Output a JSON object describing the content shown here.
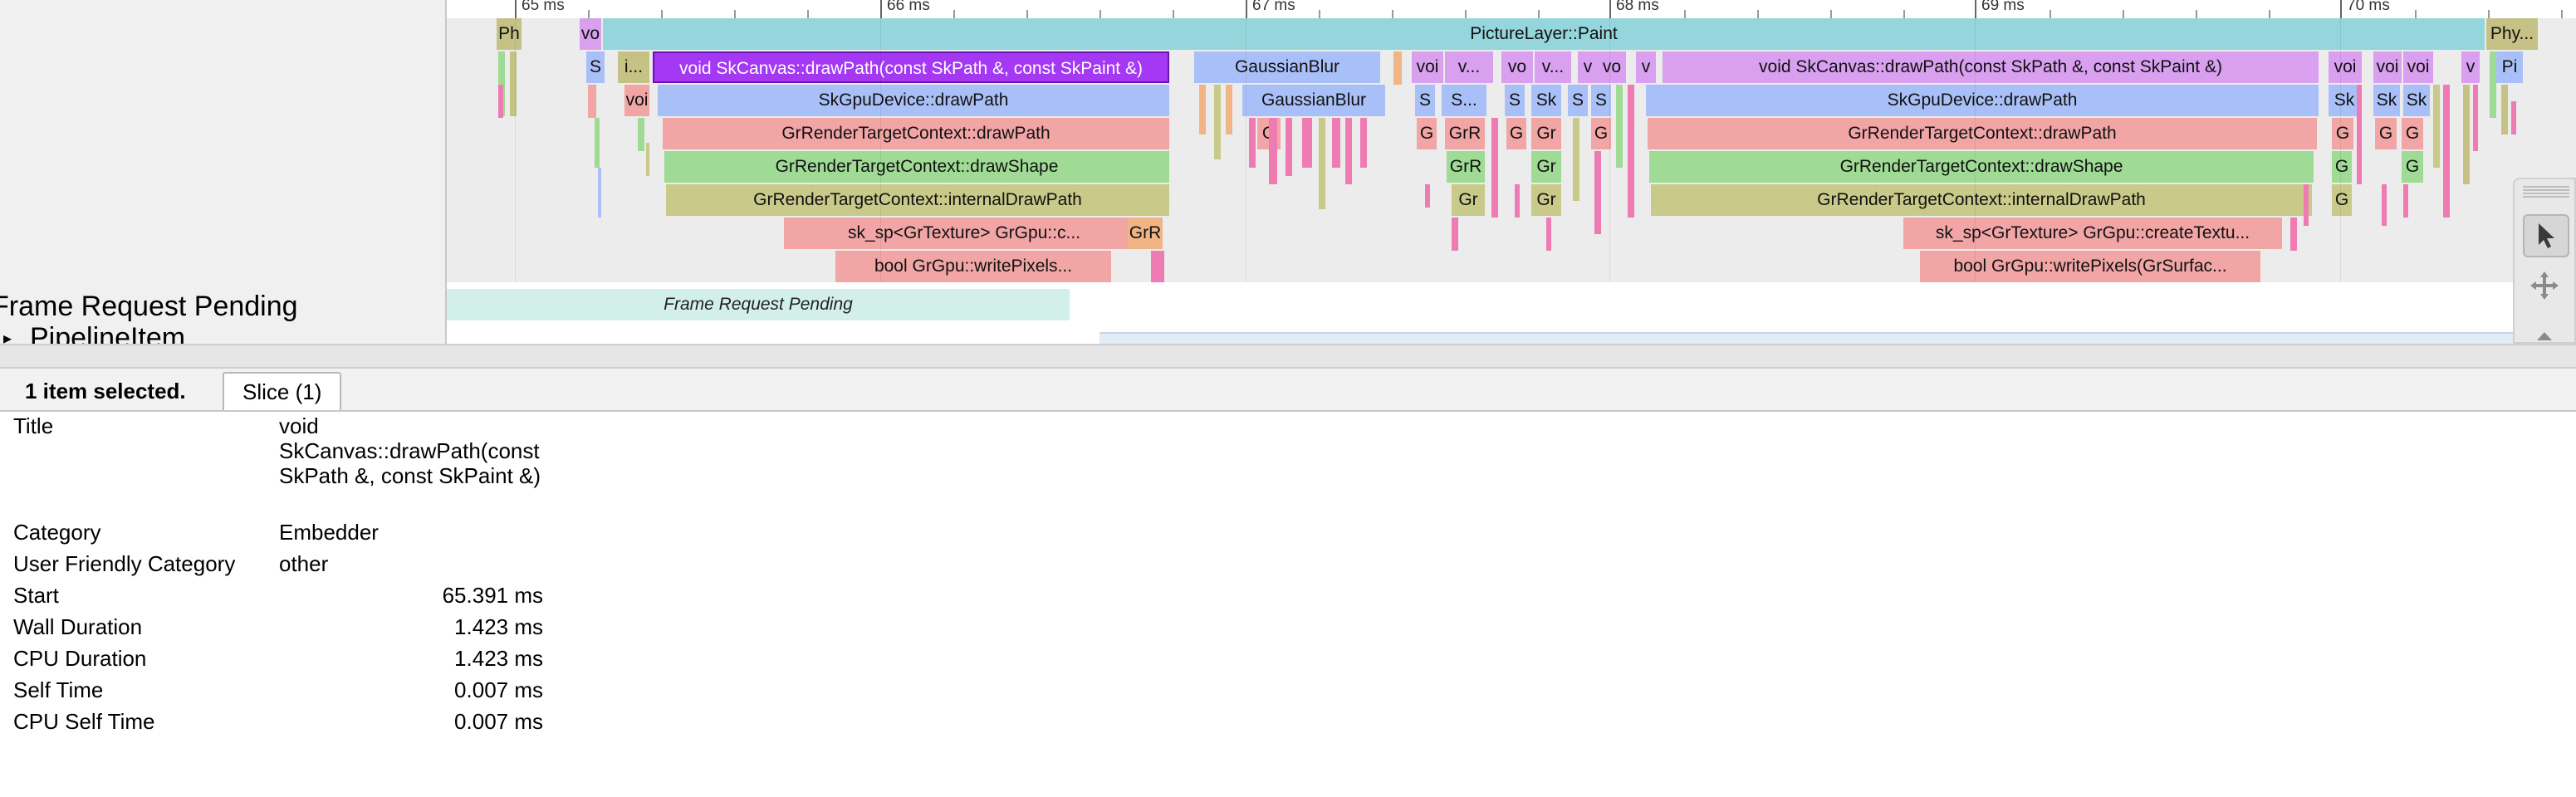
{
  "track_labels": {
    "frame_request_pending": "Frame Request Pending",
    "pipeline_item": "PipelineItem",
    "pipeline_arrow": "▸"
  },
  "ruler": {
    "major": [
      "65 ms",
      "66 ms",
      "67 ms",
      "68 ms",
      "69 ms",
      "70 ms"
    ]
  },
  "slices": {
    "picture_layer_paint": "PictureLayer::Paint",
    "ph": "Ph",
    "vo": "vo",
    "phy": "Phy...",
    "s": "S",
    "i_dots": "i...",
    "draw_path_left": "void SkCanvas::drawPath(const SkPath &, const SkPaint &)",
    "gaussian_blur_1": "GaussianBlur",
    "gaussian_blur_2": "GaussianBlur",
    "voi": "voi",
    "v_dots": "v...",
    "v": "v",
    "draw_path_right": "void SkCanvas::drawPath(const SkPath &, const SkPaint &)",
    "pi": "Pi",
    "sk_gpu_left": "SkGpuDevice::drawPath",
    "sk_gpu_right": "SkGpuDevice::drawPath",
    "s_dots": "S...",
    "sk": "Sk",
    "rtc_draw_path_left": "GrRenderTargetContext::drawPath",
    "rtc_draw_path_right": "GrRenderTargetContext::drawPath",
    "g": "G",
    "grr": "GrR",
    "gr": "Gr",
    "rtc_draw_shape_left": "GrRenderTargetContext::drawShape",
    "rtc_draw_shape_right": "GrRenderTargetContext::drawShape",
    "rtc_internal_left": "GrRenderTargetContext::internalDrawPath",
    "rtc_internal_right": "GrRenderTargetContext::internalDrawPath",
    "create_texture_left": "sk_sp<GrTexture> GrGpu::c...",
    "create_texture_right": "sk_sp<GrTexture> GrGpu::createTextu...",
    "write_pixels_left": "bool GrGpu::writePixels...",
    "write_pixels_right": "bool GrGpu::writePixels(GrSurfac...",
    "frame_request_pending": "Frame Request Pending"
  },
  "colors": {
    "teal": "#94d6db",
    "khaki": "#c6c286",
    "violet": "#d9a0f0",
    "violet_selected": "#a438f5",
    "blue": "#a9bff7",
    "salmon": "#f1a5a5",
    "green": "#9fdb95",
    "olive": "#c9c98a",
    "pink": "#ef7bb3",
    "orange": "#f1b585"
  },
  "analysis": {
    "selection_summary": "1 item selected.",
    "tab": "Slice (1)",
    "rows": [
      {
        "label": "Title",
        "value": "void SkCanvas::drawPath(const SkPath &, const SkPaint &)"
      },
      {
        "label": "Category",
        "value": "Embedder"
      },
      {
        "label": "User Friendly Category",
        "value": "other"
      },
      {
        "label": "Start",
        "value": "65.391 ms"
      },
      {
        "label": "Wall Duration",
        "value": "1.423 ms"
      },
      {
        "label": "CPU Duration",
        "value": "1.423 ms"
      },
      {
        "label": "Self Time",
        "value": "0.007 ms"
      },
      {
        "label": "CPU Self Time",
        "value": "0.007 ms"
      }
    ]
  },
  "tools": [
    "select-tool",
    "pan-tool",
    "zoom-tool"
  ]
}
